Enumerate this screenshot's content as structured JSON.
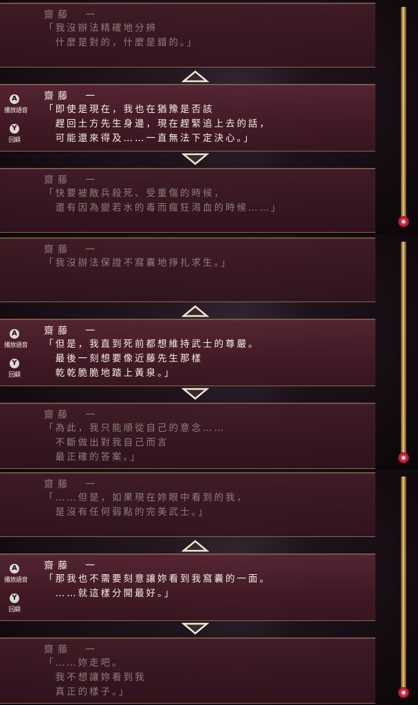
{
  "frames": [
    {
      "blocks": [
        {
          "speaker": "齋藤　一",
          "lines": [
            "「我沒辦法精確地分辨",
            "　什麼是對的，什麼是錯的。」"
          ],
          "active": false
        },
        {
          "speaker": "齋藤　一",
          "lines": [
            "「即使是現在，我也在猶豫是否該",
            "　趕回土方先生身邊，現在趕緊追上去的話，",
            "　可能還來得及……一直無法下定決心。」"
          ],
          "active": true
        },
        {
          "speaker": "齋藤　一",
          "lines": [
            "「快要被敵兵殺死、受重傷的時候，",
            "　還有因為變若水的毒而瘋狂渴血的時候……」"
          ],
          "active": false
        }
      ],
      "buttons": {
        "a_label": "播放語音",
        "y_label": "回顧"
      }
    },
    {
      "blocks": [
        {
          "speaker": "齋藤　一",
          "lines": [
            "「我沒辦法保證不窩囊地掙扎求生。」"
          ],
          "active": false
        },
        {
          "speaker": "齋藤　一",
          "lines": [
            "「但是，我直到死前都想維持武士的尊嚴。",
            "　最後一刻想要像近藤先生那樣",
            "　乾乾脆脆地踏上黃泉。」"
          ],
          "active": true
        },
        {
          "speaker": "齋藤　一",
          "lines": [
            "「為此，我只能順從自己的意念……",
            "　不斷做出對我自己而言",
            "　最正確的答案。」"
          ],
          "active": false
        }
      ],
      "buttons": {
        "a_label": "播放語音",
        "y_label": "回顧"
      }
    },
    {
      "blocks": [
        {
          "speaker": "齋藤　一",
          "lines": [
            "「……但是，如果現在妳眼中看到的我，",
            "　是沒有任何弱點的完美武士。」"
          ],
          "active": false
        },
        {
          "speaker": "齋藤　一",
          "lines": [
            "「那我也不需要刻意讓妳看到我窩囊的一面。",
            "　……就這樣分開最好。」"
          ],
          "active": true
        },
        {
          "speaker": "齋藤　一",
          "lines": [
            "「……妳走吧。",
            "　我不想讓妳看到我",
            "　真正的樣子。」"
          ],
          "active": false
        }
      ],
      "buttons": {
        "a_label": "播放語音",
        "y_label": "回顧"
      }
    }
  ],
  "icons": {
    "up": "scroll-up-arrow-icon",
    "down": "scroll-down-arrow-icon",
    "a": "a-button-icon",
    "y": "y-button-icon"
  },
  "colors": {
    "panel": "#582634",
    "border": "#8a6a50",
    "text": "#f6efe3",
    "dim_text": "#8f7e7c",
    "scrollbar": "#d9b15a",
    "knob": "#c01e3c"
  }
}
